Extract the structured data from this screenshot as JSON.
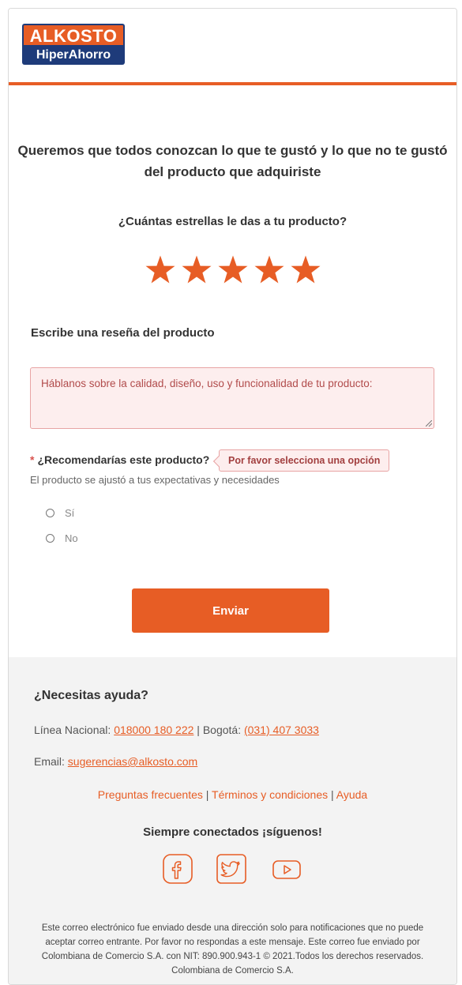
{
  "header": {
    "logo_top": "ALKOSTO",
    "logo_bottom": "HiperAhorro"
  },
  "form": {
    "title": "Queremos que todos conozcan lo que te gustó y lo que no te gustó del producto que adquiriste",
    "rating_question": "¿Cuántas estrellas le das a tu producto?",
    "rating": 5,
    "rating_max": 5,
    "review_label": "Escribe una reseña del producto",
    "review_placeholder": "Háblanos sobre la calidad, diseño, uso y funcionalidad de tu producto:",
    "required_mark": "*",
    "recommend_question": "¿Recomendarías este producto?",
    "validation_message": "Por favor selecciona una opción",
    "recommend_help": "El producto se ajustó a tus expectativas y necesidades",
    "options": [
      "Sí",
      "No"
    ],
    "submit_label": "Enviar"
  },
  "footer": {
    "help_title": "¿Necesitas ayuda?",
    "national_label": "Línea Nacional:",
    "national_phone": "018000 180 222",
    "separator": "|",
    "bogota_label": "Bogotá:",
    "bogota_phone": "(031) 407 3033",
    "email_label": "Email:",
    "email": "sugerencias@alkosto.com",
    "links": [
      "Preguntas frecuentes",
      "Términos y condiciones",
      "Ayuda"
    ],
    "social_title": "Siempre conectados ¡síguenos!",
    "social_icons": [
      "facebook-icon",
      "twitter-icon",
      "youtube-icon"
    ],
    "disclaimer": "Este correo electrónico fue enviado desde una dirección solo para notificaciones que no puede aceptar correo entrante. Por favor no respondas a este mensaje. Este correo fue enviado por Colombiana de Comercio S.A. con NIT: 890.900.943-1 © 2021.Todos los derechos reservados. Colombiana de Comercio S.A."
  },
  "colors": {
    "brand_orange": "#e75d25",
    "brand_blue": "#1e3b7a",
    "error_bg": "#fdeeee",
    "footer_bg": "#f3f3f3"
  }
}
